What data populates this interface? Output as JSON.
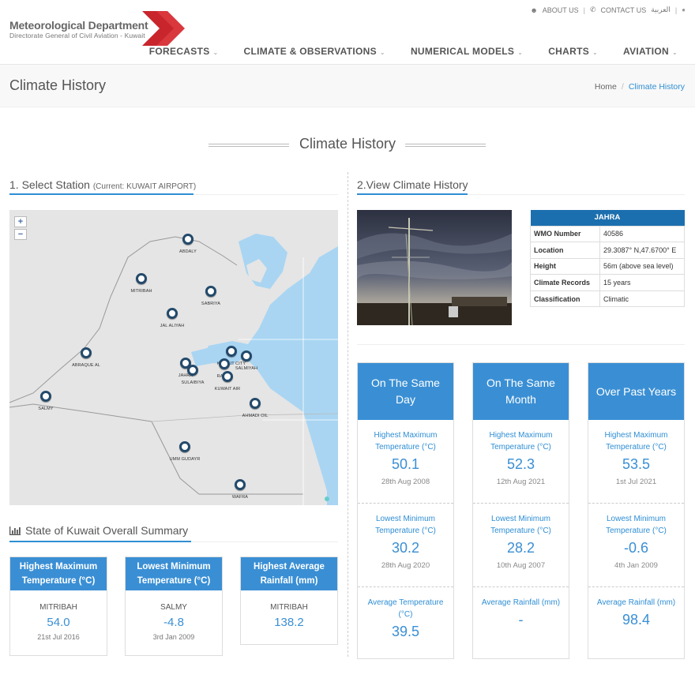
{
  "header": {
    "logo_title": "Meteorological Department",
    "logo_subtitle": "Directorate General of Civil Aviation - Kuwait",
    "top_links": [
      "ABOUT US",
      "CONTACT US",
      "العربية"
    ],
    "nav": [
      "FORECASTS",
      "CLIMATE & OBSERVATIONS",
      "NUMERICAL MODELS",
      "CHARTS",
      "AVIATION"
    ]
  },
  "titlebar": {
    "title": "Climate History",
    "breadcrumb_home": "Home",
    "breadcrumb_sep": "/",
    "breadcrumb_current": "Climate History"
  },
  "section_title": "Climate History",
  "left": {
    "heading": "1. Select Station",
    "current": "(Current: KUWAIT AIRPORT)",
    "zoom_in": "+",
    "zoom_out": "−",
    "stations": [
      "ABDALY",
      "MITRIBAH",
      "SABRIYA",
      "JAL ALIYAH",
      "ABRAQUE AL",
      "JAHRA",
      "SULAIBIYA",
      "KUWAIT CITY",
      "SALMIYAH",
      "RAYAH",
      "KUWAIT AIR",
      "AHMADI OIL",
      "SALMY",
      "UMM GUDAYR",
      "WAFRA"
    ]
  },
  "summary": {
    "heading": "State of Kuwait Overall Summary",
    "cards": [
      {
        "title": "Highest Maximum Temperature (°C)",
        "station": "MITRIBAH",
        "value": "54.0",
        "date": "21st Jul 2016"
      },
      {
        "title": "Lowest Minimum Temperature (°C)",
        "station": "SALMY",
        "value": "-4.8",
        "date": "3rd Jan 2009"
      },
      {
        "title": "Highest Average Rainfall (mm)",
        "station": "MITRIBAH",
        "value": "138.2",
        "date": ""
      }
    ]
  },
  "right": {
    "heading": "2.View Climate History",
    "station_table": {
      "name": "JAHRA",
      "rows": [
        {
          "key": "WMO Number",
          "value": "40586"
        },
        {
          "key": "Location",
          "value": "29.3087° N,47.6700° E"
        },
        {
          "key": "Height",
          "value": "56m (above sea level)"
        },
        {
          "key": "Climate Records",
          "value": "15 years"
        },
        {
          "key": "Classification",
          "value": "Climatic"
        }
      ]
    },
    "cards": [
      {
        "title": "On The Same Day",
        "cells": [
          {
            "label": "Highest Maximum Temperature (°C)",
            "value": "50.1",
            "date": "28th Aug 2008"
          },
          {
            "label": "Lowest Minimum Temperature (°C)",
            "value": "30.2",
            "date": "28th Aug 2020"
          },
          {
            "label": "Average Temperature (°C)",
            "value": "39.5",
            "date": ""
          }
        ]
      },
      {
        "title": "On The Same Month",
        "cells": [
          {
            "label": "Highest Maximum Temperature (°C)",
            "value": "52.3",
            "date": "12th Aug 2021"
          },
          {
            "label": "Lowest Minimum Temperature (°C)",
            "value": "28.2",
            "date": "10th Aug 2007"
          },
          {
            "label": "Average Rainfall (mm)",
            "value": "-",
            "date": ""
          }
        ]
      },
      {
        "title": "Over Past Years",
        "cells": [
          {
            "label": "Highest Maximum Temperature (°C)",
            "value": "53.5",
            "date": "1st Jul 2021"
          },
          {
            "label": "Lowest Minimum Temperature (°C)",
            "value": "-0.6",
            "date": "4th Jan 2009"
          },
          {
            "label": "Average Rainfall (mm)",
            "value": "98.4",
            "date": ""
          }
        ]
      }
    ]
  },
  "colors": {
    "accent": "#3a8fd4",
    "table_header": "#1c6fae",
    "logo_red": "#c8262c",
    "sea": "#a9d5f2",
    "marker": "#234a6b"
  },
  "icons": [
    "user-icon",
    "phone-icon",
    "globe-icon",
    "bar-chart-icon"
  ]
}
